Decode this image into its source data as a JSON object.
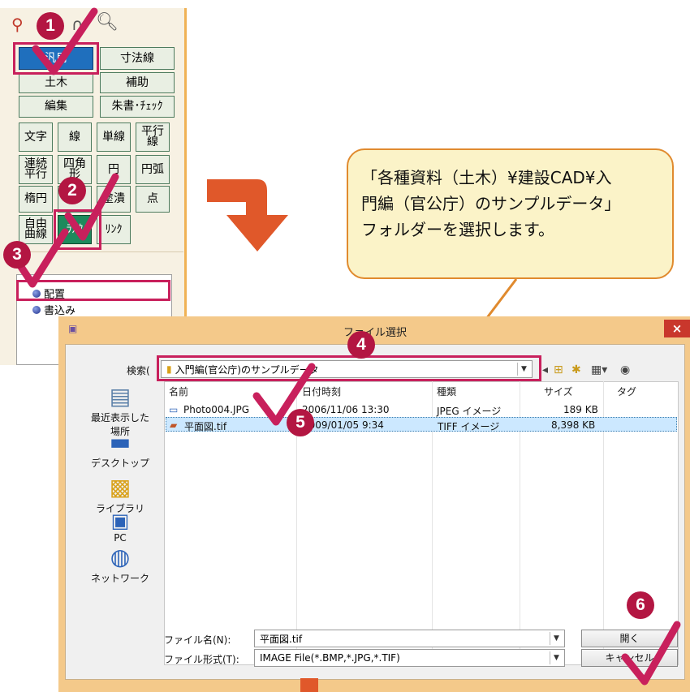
{
  "palette": {
    "buttons_top": [
      "汎用",
      "寸法線",
      "土木",
      "補助",
      "編集",
      "朱書･ﾁｪｯｸ"
    ],
    "grid": [
      [
        "文字",
        "線",
        "単線",
        "平行\n線"
      ],
      [
        "連続\n平行",
        "四角\n形",
        "円",
        "円弧"
      ],
      [
        "楕円",
        "",
        "塗潰",
        "点"
      ],
      [
        "自由\n曲線",
        "ﾗｽﾀ",
        "ﾘﾝｸ",
        ""
      ]
    ],
    "radios": [
      "配置",
      "書込み"
    ]
  },
  "badges": [
    "1",
    "2",
    "3",
    "4",
    "5",
    "6"
  ],
  "callout": {
    "text": "「各種資料（土木）¥建設CAD¥入\n門編（官公庁）のサンプルデータ」\nフォルダーを選択します。"
  },
  "dialog": {
    "title": "ファイル選択",
    "search_label": "検索(",
    "search_value": "入門編(官公庁)のサンプルデータ",
    "columns": [
      "名前",
      "日付時刻",
      "種類",
      "サイズ",
      "タグ"
    ],
    "files": [
      {
        "name": "Photo004.JPG",
        "date": "2006/11/06 13:30",
        "type": "JPEG イメージ",
        "size": "189 KB"
      },
      {
        "name": "平面図.tif",
        "date": "2009/01/05 9:34",
        "type": "TIFF イメージ",
        "size": "8,398 KB"
      }
    ],
    "nav": [
      "最近表示した場所",
      "デスクトップ",
      "ライブラリ",
      "PC",
      "ネットワーク"
    ],
    "filename_label": "ファイル名(N):",
    "filename_value": "平面図.tif",
    "filetype_label": "ファイル形式(T):",
    "filetype_value": "IMAGE File(*.BMP,*.JPG,*.TIF)",
    "open_label": "開く",
    "cancel_label": "キャンセル",
    "close_symbol": "×"
  },
  "colors": {
    "badge": "#b31642",
    "highlight": "#c8205c",
    "arrow": "#e0582a",
    "callout_fill": "#fbf3c8",
    "callout_border": "#e08a2e"
  }
}
